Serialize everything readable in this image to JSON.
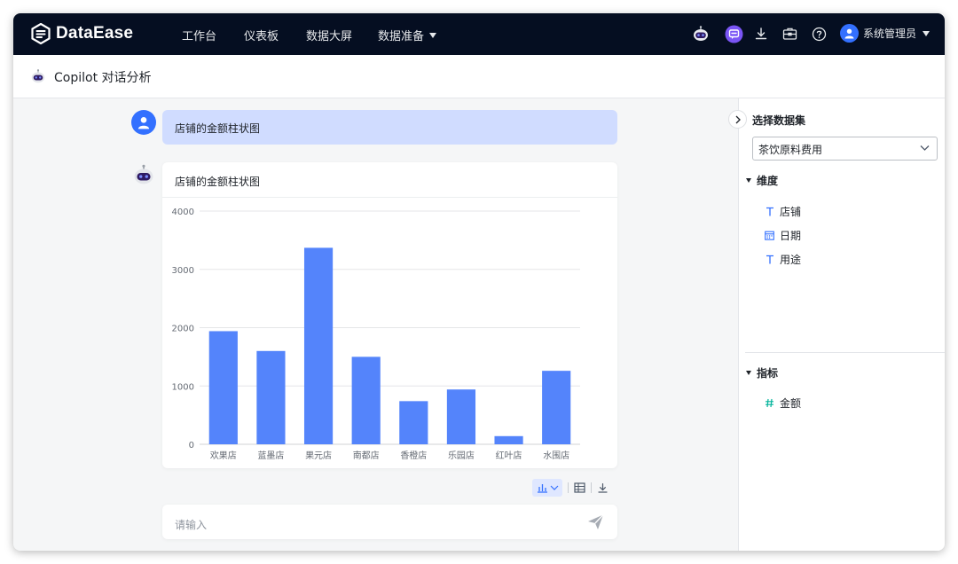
{
  "app": {
    "logo_text": "DataEase",
    "nav": [
      {
        "label": "工作台"
      },
      {
        "label": "仪表板"
      },
      {
        "label": "数据大屏"
      },
      {
        "label": "数据准备"
      }
    ],
    "user_name": "系统管理员"
  },
  "page": {
    "title": "Copilot 对话分析"
  },
  "chat": {
    "user_message": "店铺的金额柱状图",
    "bot_chart_title": "店铺的金额柱状图",
    "input_placeholder": "请输入"
  },
  "panel": {
    "select_dataset_label": "选择数据集",
    "dataset_value": "茶饮原料费用",
    "dimensions_label": "维度",
    "dimensions": [
      {
        "name": "店铺",
        "icon": "text-field-icon"
      },
      {
        "name": "日期",
        "icon": "date-field-icon"
      },
      {
        "name": "用途",
        "icon": "text-field-icon"
      }
    ],
    "metrics_label": "指标",
    "metrics": [
      {
        "name": "金额",
        "icon": "number-field-icon"
      }
    ]
  },
  "colors": {
    "accent": "#3370ff",
    "bar": "#5484fb",
    "topbar": "#050e21",
    "user_bubble": "#d0dcff"
  },
  "chart_data": {
    "type": "bar",
    "categories": [
      "欢果店",
      "蓝墨店",
      "果元店",
      "南都店",
      "香橙店",
      "乐园店",
      "红叶店",
      "水围店"
    ],
    "values": [
      1940,
      1600,
      3370,
      1500,
      740,
      940,
      140,
      1260
    ],
    "yticks": [
      "0",
      "1000",
      "2000",
      "3000",
      "4000"
    ],
    "ylim": [
      0,
      4000
    ],
    "grid": true
  }
}
